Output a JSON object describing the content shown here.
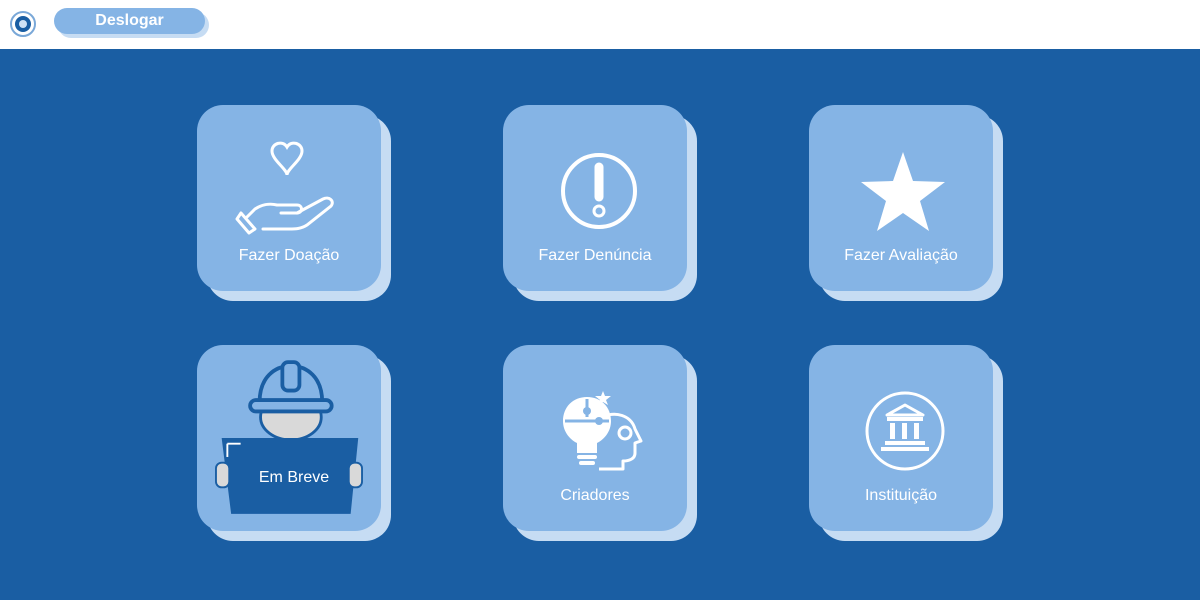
{
  "header": {
    "logout_label": "Deslogar",
    "logo_icon": "institution-seal-icon"
  },
  "menu": {
    "donation": {
      "label": "Fazer Doação",
      "icon": "heart-in-hand-icon"
    },
    "report": {
      "label": "Fazer Denúncia",
      "icon": "exclamation-circle-icon"
    },
    "review": {
      "label": "Fazer Avaliação",
      "icon": "star-icon"
    },
    "coming_soon": {
      "label": "Em Breve",
      "icon": "construction-worker-icon"
    },
    "creators": {
      "label": "Criadores",
      "icon": "puzzle-head-icon"
    },
    "institution": {
      "label": "Instituição",
      "icon": "bank-building-icon"
    }
  },
  "colors": {
    "background": "#1a5ea3",
    "tile": "#85b4e5",
    "tile_shadow": "#c6dcf3",
    "text": "#ffffff"
  }
}
